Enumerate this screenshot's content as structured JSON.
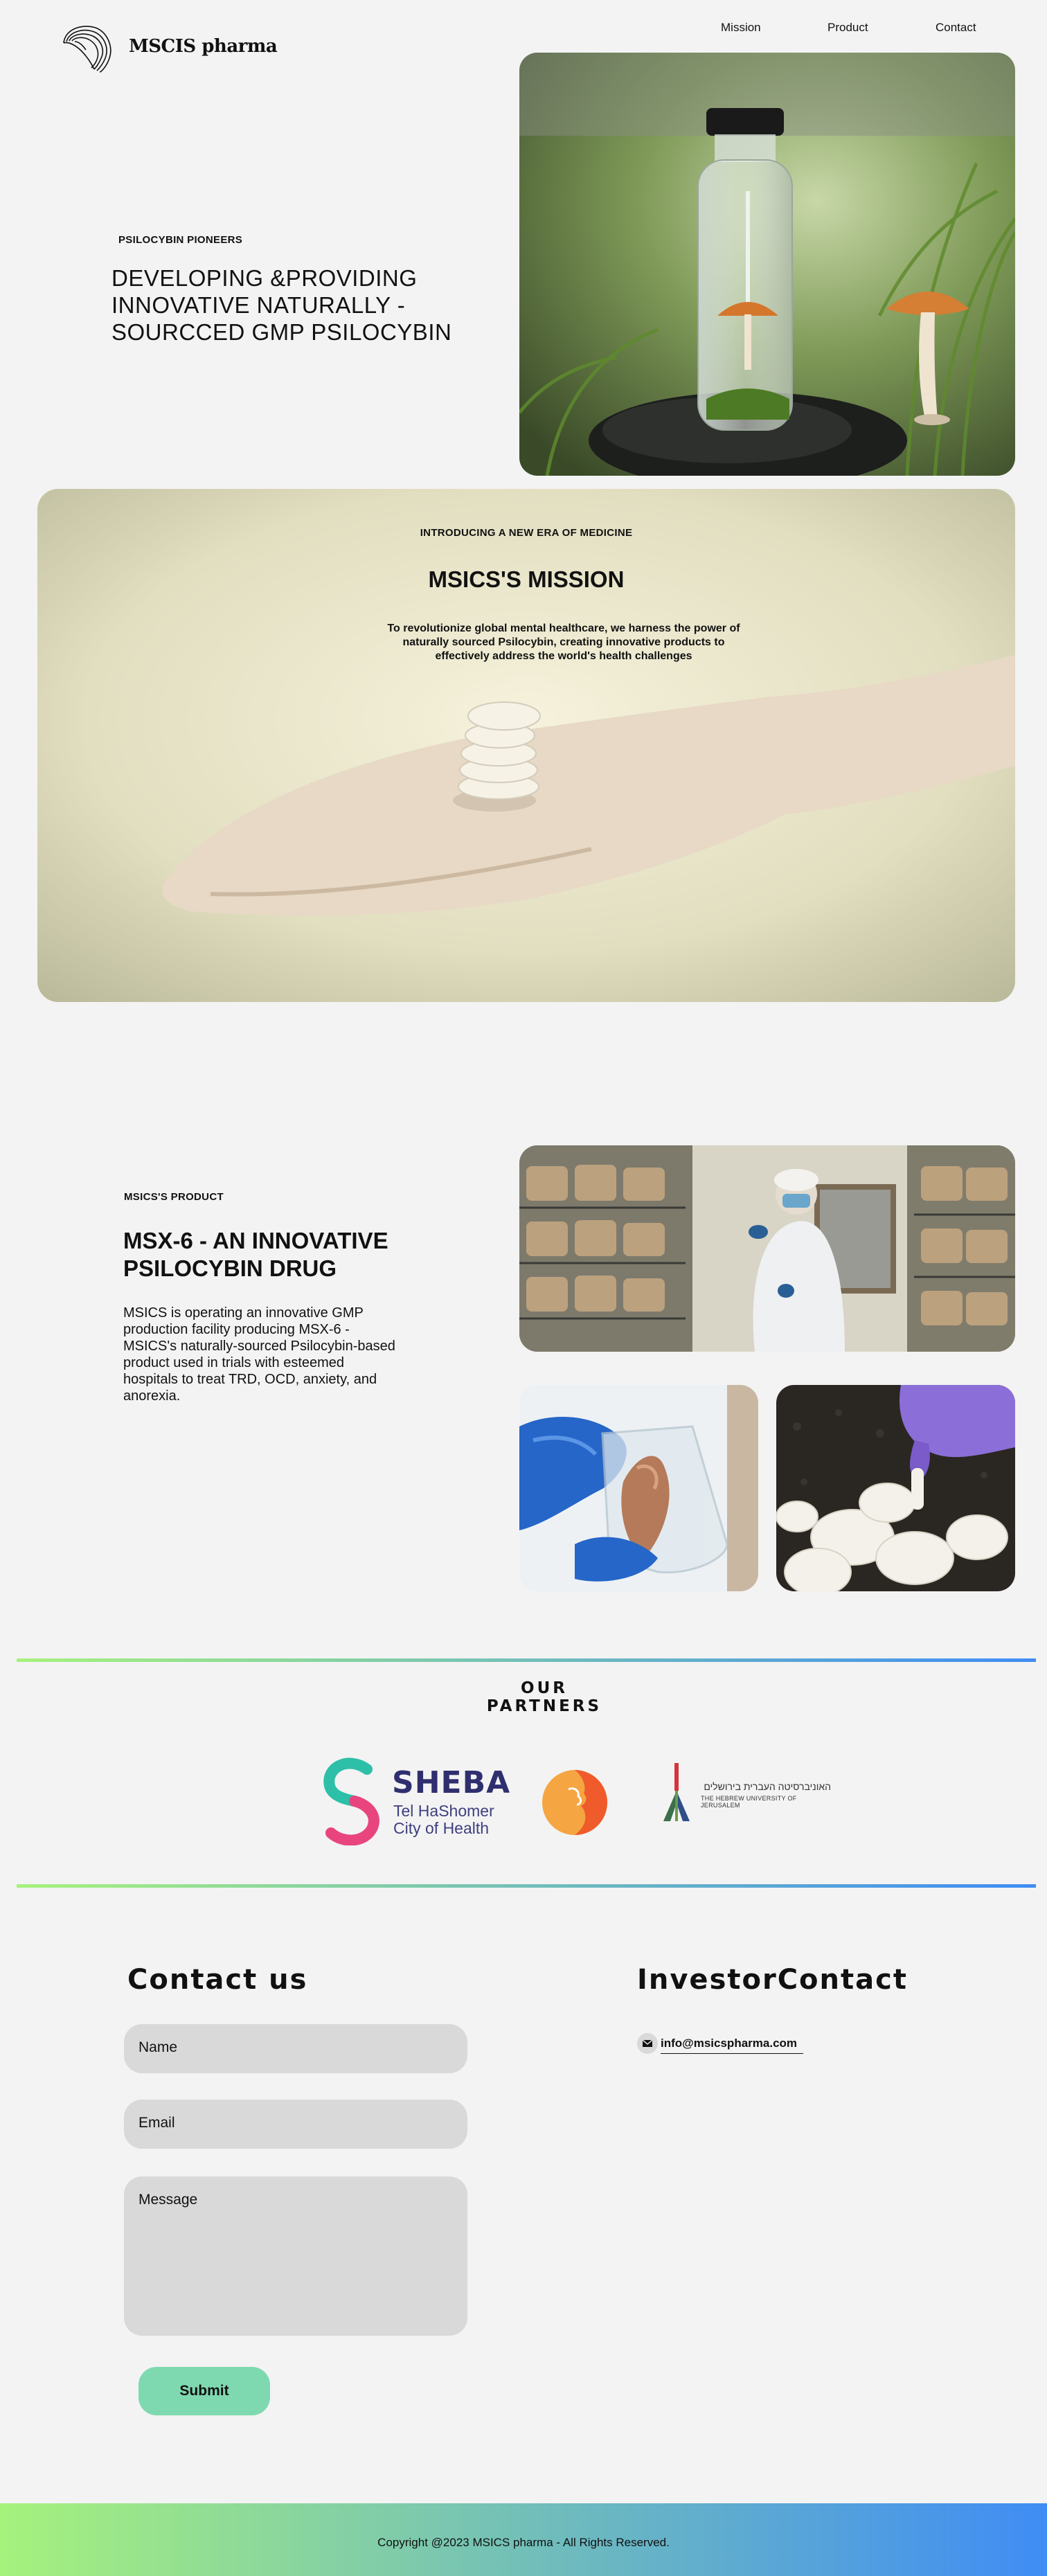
{
  "header": {
    "brand": "MSCIS pharma",
    "nav": [
      "Mission",
      "Product",
      "Contact"
    ]
  },
  "hero": {
    "eyebrow": "PSILOCYBIN PIONEERS",
    "title": "DEVELOPING  &PROVIDING INNOVATIVE NATURALLY - SOURCCED GMP PSILOCYBIN"
  },
  "mission": {
    "eyebrow": "INTRODUCING A NEW ERA OF MEDICINE",
    "title": "MSICS'S MISSION",
    "body": "To revolutionize global mental healthcare, we harness the power of naturally sourced Psilocybin, creating innovative products to effectively address the world's health challenges"
  },
  "product": {
    "eyebrow": "MSICS'S PRODUCT",
    "title": "MSX-6 - AN INNOVATIVE PSILOCYBIN DRUG",
    "description": "MSICS is operating an innovative GMP production facility producing MSX-6 - MSICS's naturally-sourced Psilocybin-based product used in trials with esteemed hospitals to treat TRD, OCD, anxiety, and anorexia."
  },
  "partners": {
    "title_line1": "OUR",
    "title_line2": "PARTNERS",
    "sheba": {
      "name": "SHEBA",
      "line2": "Tel HaShomer",
      "line3": "City of Health"
    },
    "huji": {
      "hebrew": "האוניברסיטה העברית בירושלים",
      "english": "THE HEBREW UNIVERSITY OF JERUSALEM"
    }
  },
  "contact": {
    "heading": "Contact us",
    "name_placeholder": "Name",
    "email_placeholder": "Email",
    "message_placeholder": "Message",
    "submit_label": "Submit"
  },
  "investor": {
    "heading": "InvestorContact",
    "email": "info@msicspharma.com"
  },
  "footer": {
    "copyright": "Copyright @2023 MSICS pharma - All Rights Reserved."
  },
  "colors": {
    "background": "#f3f3f3",
    "accent_green": "#a6f27c",
    "accent_blue": "#3f8cf5",
    "submit_button": "#7fd9b0",
    "field_fill": "#d9d9d9",
    "sheba_navy": "#2f2f6f",
    "sheba_teal": "#2dbfa8",
    "sheba_pink": "#e8457e"
  },
  "icons": {
    "logo": "mushroom-cap-lines-icon",
    "email": "envelope-icon"
  }
}
